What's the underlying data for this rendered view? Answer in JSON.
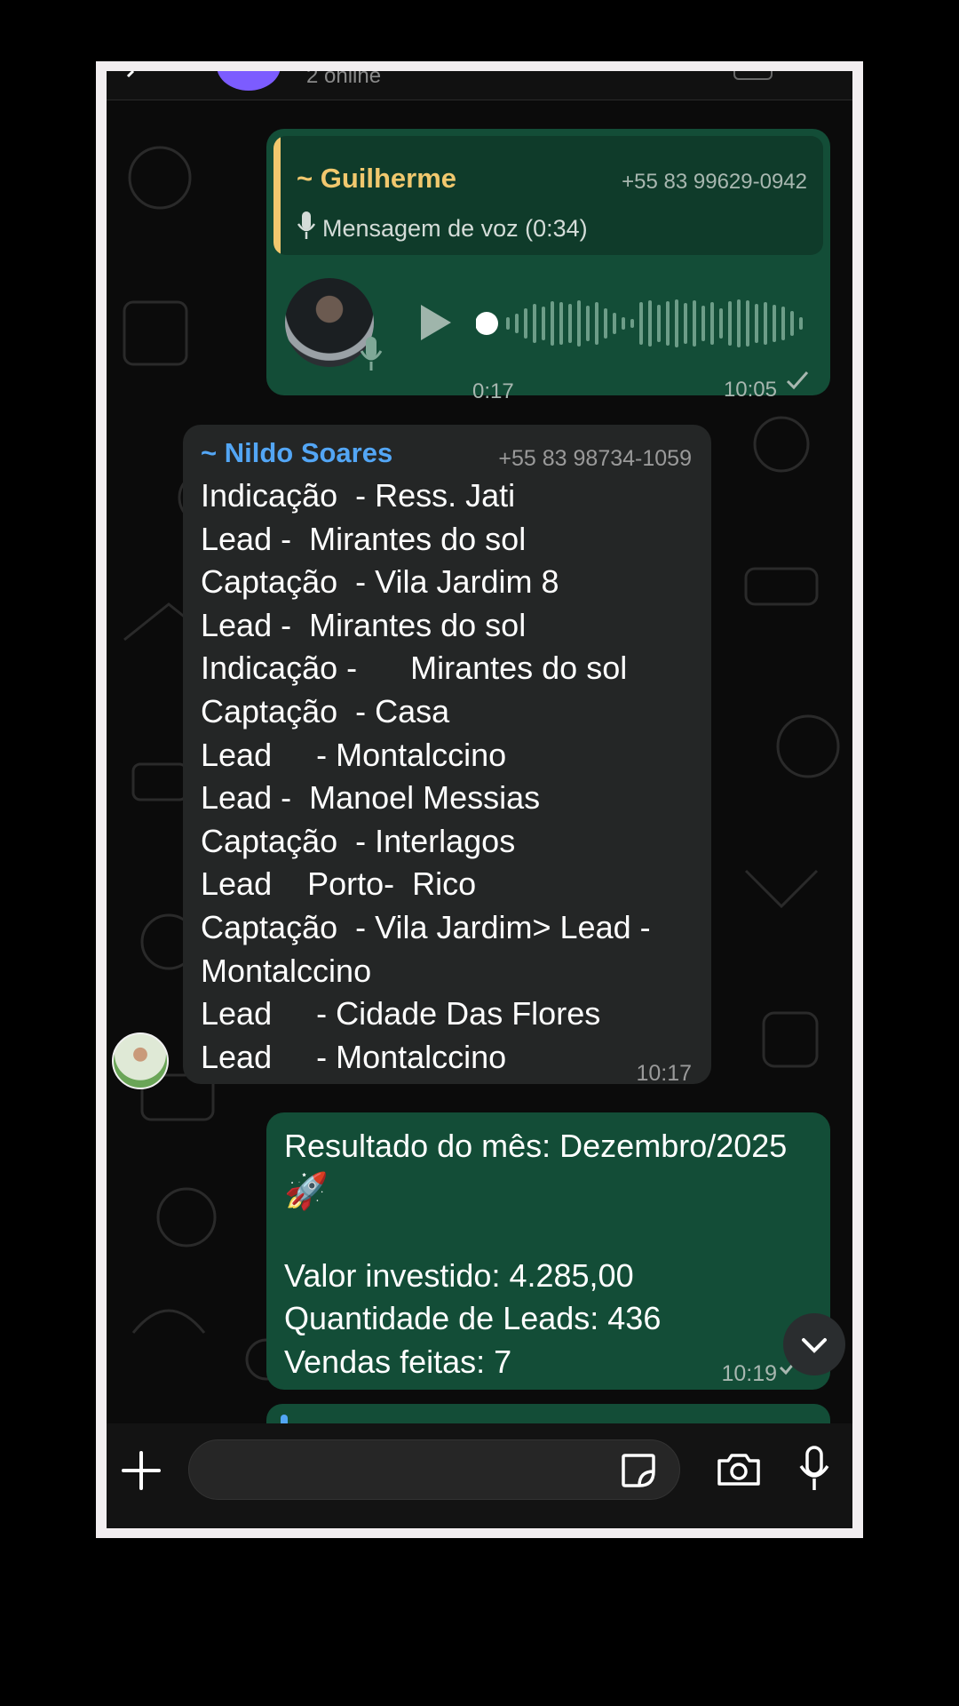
{
  "header": {
    "subtitle": "2 online"
  },
  "messages": {
    "voice_reply": {
      "quote_name": "~ Guilherme",
      "quote_phone": "+55 83 99629-0942",
      "quote_text": "Mensagem de voz (0:34)",
      "duration": "0:17",
      "time": "10:05"
    },
    "list_message": {
      "sender_name": "~ Nildo Soares",
      "sender_phone": "+55 83 98734-1059",
      "lines": [
        "Indicação  - Ress. Jati",
        "Lead -  Mirantes do sol",
        "Captação  - Vila Jardim 8",
        "Lead -  Mirantes do sol",
        "Indicação -      Mirantes do sol",
        "Captação  - Casa",
        "Lead     - Montalccino",
        "Lead -  Manoel Messias",
        "Captação  - Interlagos",
        "Lead    Porto-  Rico",
        "Captação  - Vila Jardim> Lead -",
        "Montalccino",
        "Lead     - Cidade Das Flores",
        "Lead     - Montalccino"
      ],
      "time": "10:17"
    },
    "result_message": {
      "text": "Resultado do mês: Dezembro/2025\n\n\nValor investido: 4.285,00\nQuantidade de Leads: 436\nVendas feitas: 7",
      "emoji": "🚀",
      "time": "10:19"
    }
  },
  "composer": {
    "placeholder": ""
  },
  "icons": {
    "back": "chevron-left-icon",
    "play": "play-icon",
    "mic": "microphone-icon",
    "check": "checkmark-icon",
    "plus": "plus-icon",
    "sticker": "sticker-icon",
    "camera": "camera-icon",
    "scroll": "chevron-down-icon",
    "rocket": "rocket-icon"
  },
  "colors": {
    "outgoing_bubble": "#134d37",
    "incoming_bubble": "#242626",
    "quote_accent": "#f1c86e",
    "sender_accent": "#53a6f5",
    "group_avatar": "#7c5cff"
  }
}
